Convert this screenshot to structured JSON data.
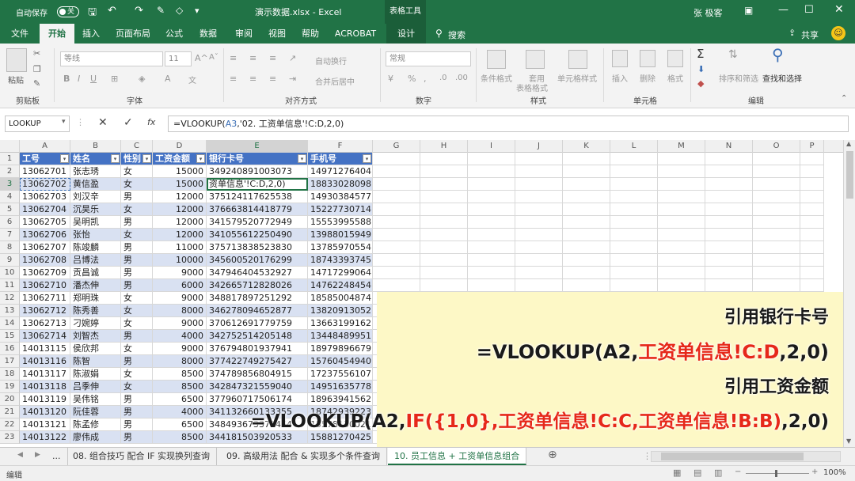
{
  "titlebar": {
    "autosave_label": "自动保存",
    "autosave_state": "关",
    "filename": "演示数据.xlsx - Excel",
    "context_tools": "表格工具",
    "user": "张 极客"
  },
  "tabs": [
    "文件",
    "开始",
    "插入",
    "页面布局",
    "公式",
    "数据",
    "审阅",
    "视图",
    "帮助",
    "ACROBAT",
    "设计"
  ],
  "search_label": "搜索",
  "share_label": "共享",
  "ribbon": {
    "clipboard": {
      "paste": "粘贴",
      "label": "剪贴板"
    },
    "font": {
      "name": "等线",
      "size": "11",
      "label": "字体"
    },
    "alignment": {
      "wrap": "自动换行",
      "merge": "合并后居中",
      "label": "对齐方式"
    },
    "number": {
      "format": "常规",
      "label": "数字"
    },
    "styles": {
      "cond": "条件格式",
      "table1": "套用",
      "table2": "表格格式",
      "cell_styles": "单元格样式",
      "label": "样式"
    },
    "cells": {
      "insert": "插入",
      "delete": "删除",
      "format": "格式",
      "label": "单元格"
    },
    "editing": {
      "sort": "排序和筛选",
      "find": "查找和选择",
      "label": "编辑"
    }
  },
  "formula_bar": {
    "name_box": "LOOKUP",
    "formula_prefix": "=VLOOKUP(",
    "formula_ref": "A3",
    "formula_suffix": ",'02. 工资单信息'!C:D,2,0)"
  },
  "columns": [
    "A",
    "B",
    "C",
    "D",
    "E",
    "F",
    "G",
    "H",
    "I",
    "J",
    "K",
    "L",
    "M",
    "N",
    "O",
    "P"
  ],
  "headers": [
    "工号",
    "姓名",
    "性别",
    "工资金额",
    "银行卡号",
    "手机号"
  ],
  "rows": [
    [
      "13062701",
      "张志琇",
      "女",
      "15000",
      "349240891003073",
      "14971276404"
    ],
    [
      "13062702",
      "黄信盈",
      "女",
      "15000",
      "资单信息'!C:D,2,0)",
      "18833028098"
    ],
    [
      "13062703",
      "刘汉辛",
      "男",
      "12000",
      "375124117625538",
      "14930384577"
    ],
    [
      "13062704",
      "沉昊乐",
      "女",
      "12000",
      "376663814418779",
      "15227730714"
    ],
    [
      "13062705",
      "吴明凯",
      "男",
      "12000",
      "341579520772949",
      "15553995588"
    ],
    [
      "13062706",
      "张怡",
      "女",
      "12000",
      "341055612250490",
      "13988015949"
    ],
    [
      "13062707",
      "陈竣麟",
      "男",
      "11000",
      "375713838523830",
      "13785970554"
    ],
    [
      "13062708",
      "吕博法",
      "男",
      "10000",
      "345600520176299",
      "18743393745"
    ],
    [
      "13062709",
      "贡昌诚",
      "男",
      "9000",
      "347946404532927",
      "14717299064"
    ],
    [
      "13062710",
      "潘杰伸",
      "男",
      "6000",
      "342665712828026",
      "14762248454"
    ],
    [
      "13062711",
      "郑明珠",
      "女",
      "9000",
      "348817897251292",
      "18585004874"
    ],
    [
      "13062712",
      "陈秀善",
      "女",
      "8000",
      "346278094652877",
      "13820913052"
    ],
    [
      "13062713",
      "刁婉婷",
      "女",
      "9000",
      "370612691779759",
      "13663199162"
    ],
    [
      "13062714",
      "刘智杰",
      "男",
      "4000",
      "342752514205148",
      "13448489951"
    ],
    [
      "14013115",
      "侯欣邦",
      "女",
      "9000",
      "376794801937941",
      "18979896679"
    ],
    [
      "14013116",
      "陈智",
      "男",
      "8000",
      "377422749275427",
      "15760454940"
    ],
    [
      "14013117",
      "陈淑娟",
      "女",
      "8500",
      "374789856804915",
      "17237556107"
    ],
    [
      "14013118",
      "吕季伸",
      "女",
      "8500",
      "342847321559040",
      "14951635778"
    ],
    [
      "14013119",
      "吴伟铭",
      "男",
      "6500",
      "377960717506174",
      "18963941562"
    ],
    [
      "14013120",
      "阮佳蓉",
      "男",
      "4000",
      "341132660133355",
      "18742939223"
    ],
    [
      "14013121",
      "陈孟修",
      "男",
      "6500",
      "348493673371454",
      "15578130021"
    ],
    [
      "14013122",
      "廖伟成",
      "男",
      "8500",
      "344181503920533",
      "15881270425"
    ]
  ],
  "overlay": {
    "line1": "引用银行卡号",
    "line2_a": "=VLOOKUP(A2,",
    "line2_b": "工资单信息!C:D",
    "line2_c": ",2,0)",
    "line3": "引用工资金额",
    "line4_a": "=VLOOKUP(A2,",
    "line4_b": "IF({1,0},工资单信息!C:C,工资单信息!B:B)",
    "line4_c": ",2,0)"
  },
  "sheet_tabs": [
    "...",
    "08. 组合技巧 配合 IF 实现换列查询",
    "09. 高级用法 配合 & 实现多个条件查询",
    "10. 员工信息 + 工资单信息组合"
  ],
  "status": {
    "mode": "编辑",
    "zoom": "100%"
  },
  "colors": {
    "excel_green": "#217346",
    "table_header": "#4472c4",
    "band": "#d9e1f2",
    "highlight": "#fdf8c6",
    "red": "#e6281a"
  }
}
